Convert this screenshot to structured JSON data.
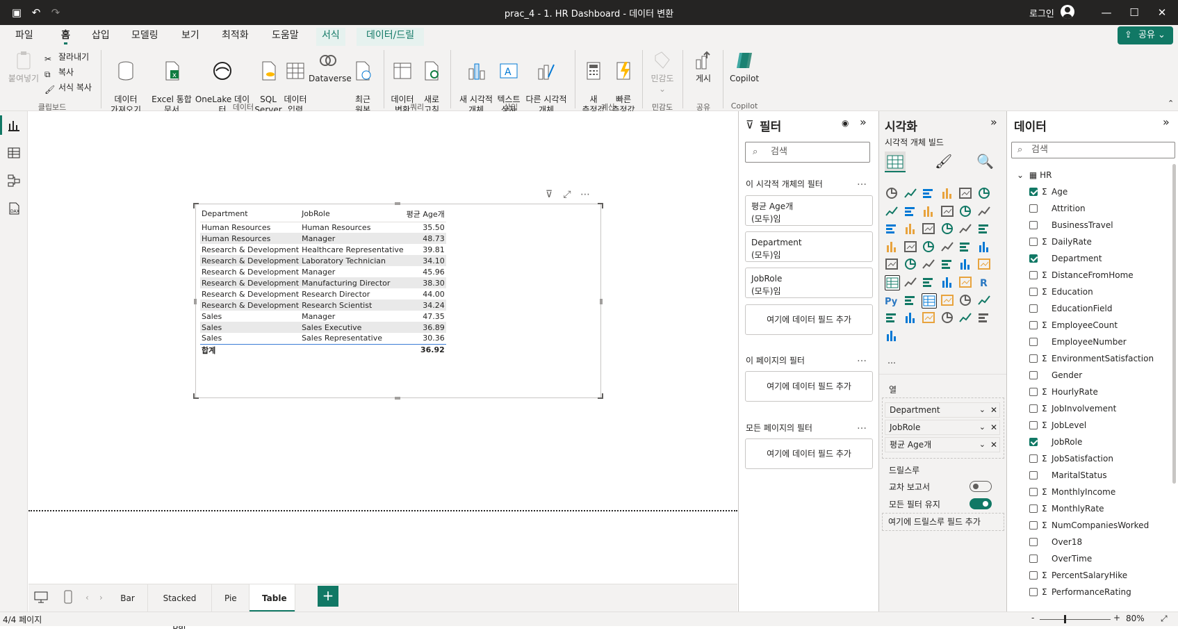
{
  "window": {
    "title": "prac_4 - 1. HR Dashboard - 데이터 변환",
    "signin": "로그인",
    "minimize": "—",
    "maximize": "☐",
    "close": "✕"
  },
  "menu": {
    "items": [
      "파일",
      "홈",
      "삽입",
      "모델링",
      "보기",
      "최적화",
      "도움말",
      "서식",
      "데이터/드릴"
    ],
    "share": "공유"
  },
  "ribbon": {
    "clipboard": {
      "paste": "붙여넣기",
      "cut": "잘라내기",
      "copy": "복사",
      "format_painter": "서식 복사",
      "group": "클립보드"
    },
    "data": {
      "get_data": "데이터\n가져오기",
      "excel": "Excel 통합\n문서",
      "onelake": "OneLake 데이터\n허브",
      "sql": "SQL\nServer",
      "enter_data": "데이터\n입력",
      "dataverse": "Dataverse",
      "recent": "최근\n원본",
      "group": "데이터"
    },
    "query": {
      "transform": "데이터\n변환",
      "refresh": "새로\n고침",
      "group": "쿼리"
    },
    "insert": {
      "new_visual": "새 시각적\n개체",
      "text_box": "텍스트\n상자",
      "more_visuals": "다른 시각적\n개체",
      "group": "삽입"
    },
    "calc": {
      "new_measure": "새\n측정값",
      "quick_measure": "빠른\n측정값",
      "group": "계산"
    },
    "sensitivity": {
      "label": "민감도",
      "group": "민감도"
    },
    "share": {
      "publish": "게시",
      "group": "공유"
    },
    "copilot": {
      "label": "Copilot",
      "group": "Copilot"
    }
  },
  "table_visual": {
    "columns": [
      "Department",
      "JobRole",
      "평균 Age개"
    ],
    "rows": [
      [
        "Human Resources",
        "Human Resources",
        "35.50"
      ],
      [
        "Human Resources",
        "Manager",
        "48.73"
      ],
      [
        "Research & Development",
        "Healthcare Representative",
        "39.81"
      ],
      [
        "Research & Development",
        "Laboratory Technician",
        "34.10"
      ],
      [
        "Research & Development",
        "Manager",
        "45.96"
      ],
      [
        "Research & Development",
        "Manufacturing Director",
        "38.30"
      ],
      [
        "Research & Development",
        "Research Director",
        "44.00"
      ],
      [
        "Research & Development",
        "Research Scientist",
        "34.24"
      ],
      [
        "Sales",
        "Manager",
        "47.35"
      ],
      [
        "Sales",
        "Sales Executive",
        "36.89"
      ],
      [
        "Sales",
        "Sales Representative",
        "30.36"
      ]
    ],
    "total_label": "합계",
    "total_value": "36.92"
  },
  "pages": {
    "tabs": [
      "Bar",
      "Stacked Bar",
      "Pie",
      "Table"
    ],
    "active": "Table",
    "add": "+"
  },
  "status": {
    "page": "4/4 페이지",
    "zoom": "80%",
    "zoom_minus": "-",
    "zoom_plus": "+"
  },
  "filters": {
    "title": "필터",
    "search_placeholder": "검색",
    "visual_section": "이 시각적 개체의 필터",
    "cards": [
      {
        "name": "평균 Age개",
        "state": "(모두)임"
      },
      {
        "name": "Department",
        "state": "(모두)임"
      },
      {
        "name": "JobRole",
        "state": "(모두)임"
      }
    ],
    "add_field": "여기에 데이터 필드 추가",
    "page_section": "이 페이지의 필터",
    "all_section": "모든 페이지의 필터",
    "more": "…"
  },
  "visualizations": {
    "title": "시각화",
    "build": "시각적 개체 빌드",
    "columns_label": "열",
    "fields": [
      "Department",
      "JobRole",
      "평균 Age개"
    ],
    "drillthrough": "드릴스루",
    "cross_report": "교차 보고서",
    "cross_report_on": false,
    "keep_filters": "모든 필터 유지",
    "keep_filters_on": true,
    "add_drill_field": "여기에 드릴스루 필드 추가",
    "more_visuals": "…",
    "r_label": "R",
    "py_label": "Py"
  },
  "data_pane": {
    "title": "데이터",
    "search_placeholder": "검색",
    "table": "HR",
    "fields": [
      {
        "name": "Age",
        "sigma": true,
        "checked": true
      },
      {
        "name": "Attrition",
        "sigma": false,
        "checked": false
      },
      {
        "name": "BusinessTravel",
        "sigma": false,
        "checked": false
      },
      {
        "name": "DailyRate",
        "sigma": true,
        "checked": false
      },
      {
        "name": "Department",
        "sigma": false,
        "checked": true
      },
      {
        "name": "DistanceFromHome",
        "sigma": true,
        "checked": false
      },
      {
        "name": "Education",
        "sigma": true,
        "checked": false
      },
      {
        "name": "EducationField",
        "sigma": false,
        "checked": false
      },
      {
        "name": "EmployeeCount",
        "sigma": true,
        "checked": false
      },
      {
        "name": "EmployeeNumber",
        "sigma": false,
        "checked": false
      },
      {
        "name": "EnvironmentSatisfaction",
        "sigma": true,
        "checked": false
      },
      {
        "name": "Gender",
        "sigma": false,
        "checked": false
      },
      {
        "name": "HourlyRate",
        "sigma": true,
        "checked": false
      },
      {
        "name": "JobInvolvement",
        "sigma": true,
        "checked": false
      },
      {
        "name": "JobLevel",
        "sigma": true,
        "checked": false
      },
      {
        "name": "JobRole",
        "sigma": false,
        "checked": true
      },
      {
        "name": "JobSatisfaction",
        "sigma": true,
        "checked": false
      },
      {
        "name": "MaritalStatus",
        "sigma": false,
        "checked": false
      },
      {
        "name": "MonthlyIncome",
        "sigma": true,
        "checked": false
      },
      {
        "name": "MonthlyRate",
        "sigma": true,
        "checked": false
      },
      {
        "name": "NumCompaniesWorked",
        "sigma": true,
        "checked": false
      },
      {
        "name": "Over18",
        "sigma": false,
        "checked": false
      },
      {
        "name": "OverTime",
        "sigma": false,
        "checked": false
      },
      {
        "name": "PercentSalaryHike",
        "sigma": true,
        "checked": false
      },
      {
        "name": "PerformanceRating",
        "sigma": true,
        "checked": false
      }
    ]
  },
  "colors": {
    "accent": "#117865",
    "titlebar": "#252423"
  }
}
